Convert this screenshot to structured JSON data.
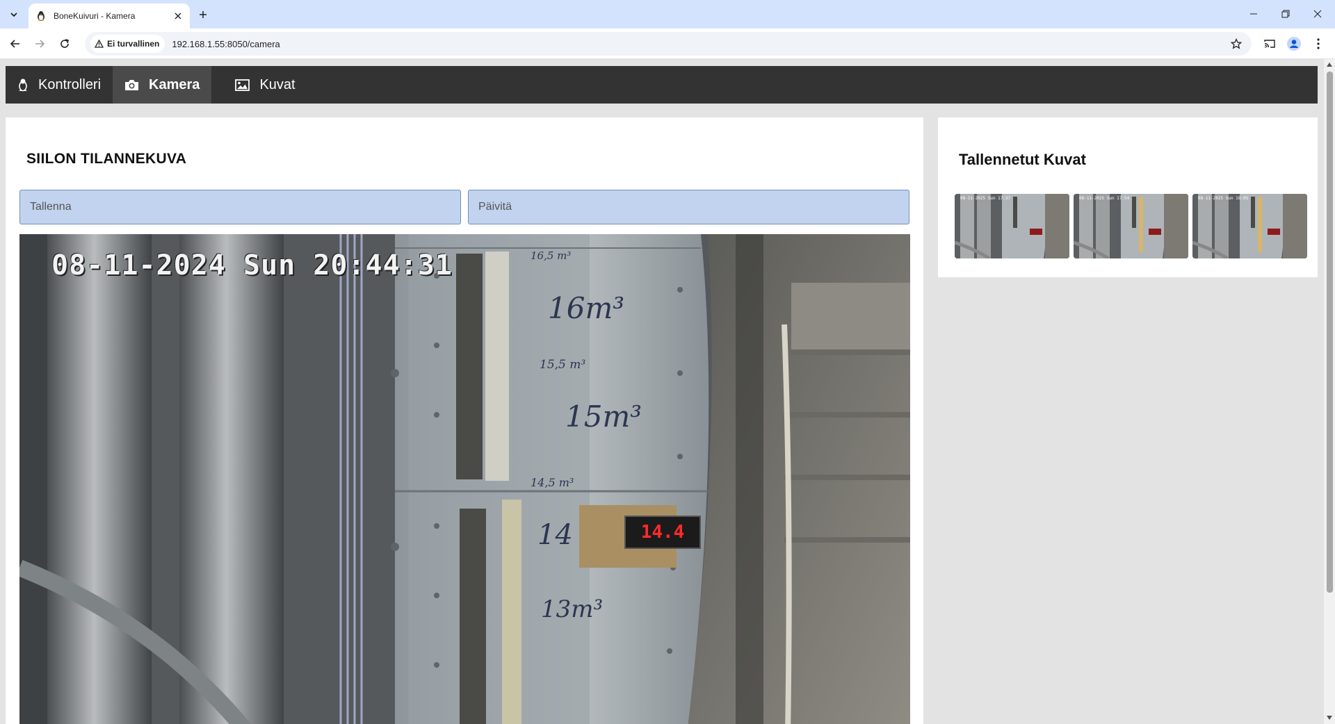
{
  "browser": {
    "tab_title": "BoneKuivuri - Kamera",
    "security_label": "Ei turvallinen",
    "url": "192.168.1.55:8050/camera"
  },
  "nav": {
    "items": [
      {
        "label": "Kontrolleri",
        "icon": "linux-icon",
        "active": false
      },
      {
        "label": "Kamera",
        "icon": "camera-icon",
        "active": true
      },
      {
        "label": "Kuvat",
        "icon": "image-icon",
        "active": false
      }
    ]
  },
  "main": {
    "title": "SIILON TILANNEKUVA",
    "save_placeholder": "Tallenna",
    "refresh_placeholder": "Päivitä",
    "camera": {
      "timestamp": "08-11-2024 Sun 20:44:31",
      "display_value": "14.4",
      "scale_labels": [
        "16,5 m³",
        "16m³",
        "15,5 m³",
        "15m³",
        "14,5 m³",
        "14",
        "13m³"
      ]
    }
  },
  "side": {
    "title": "Tallennetut Kuvat",
    "thumbnails": [
      {
        "stamp": "08-11-2025 Sun 17:37",
        "display": "14.4"
      },
      {
        "stamp": "08-11-2025 Sun 17:54",
        "display": "14.4"
      },
      {
        "stamp": "08-11-2025 Sun 18:05",
        "display": "14.4"
      }
    ]
  },
  "colors": {
    "nav_bg": "#333333",
    "nav_active": "#4a4a4a",
    "button_bg": "#c1d3ee",
    "button_border": "#6f8fc0",
    "chrome_bg": "#d3e3fd",
    "page_bg": "#e3e3e3"
  }
}
